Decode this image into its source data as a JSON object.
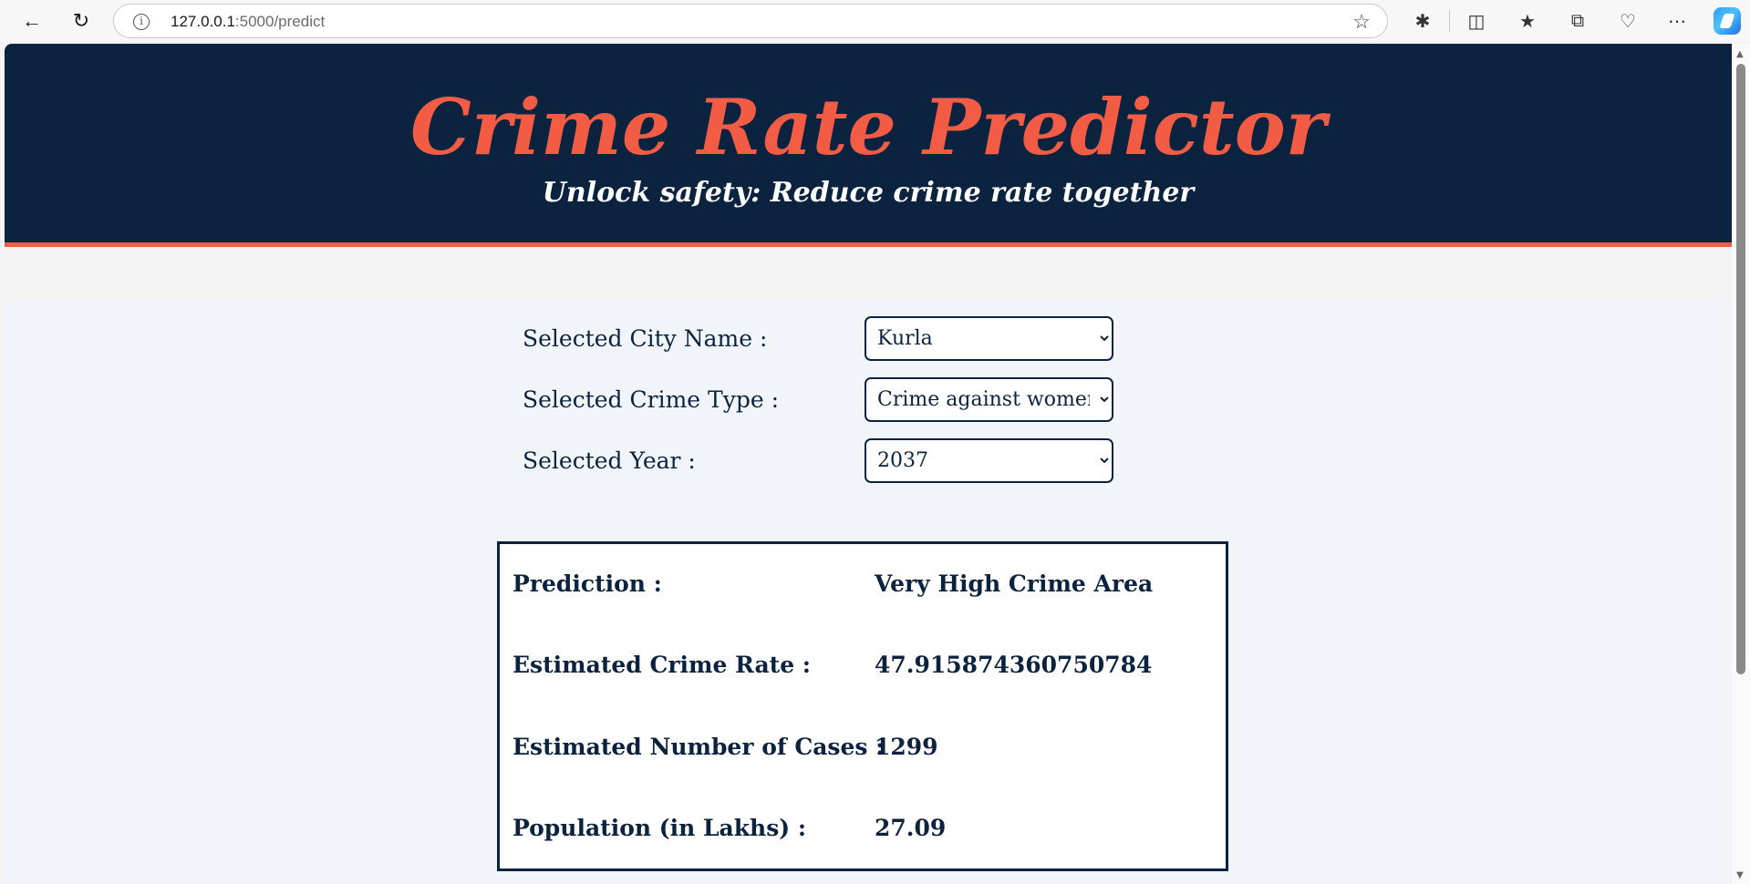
{
  "browser": {
    "url_host": "127.0.0.1",
    "url_path": ":5000/predict"
  },
  "header": {
    "title": "Crime Rate Predictor",
    "subtitle": "Unlock safety: Reduce crime rate together"
  },
  "form": {
    "city_label": "Selected City Name :",
    "city_value": "Kurla",
    "crime_label": "Selected Crime Type :",
    "crime_value": "Crime against women",
    "year_label": "Selected Year :",
    "year_value": "2037"
  },
  "results": {
    "prediction_label": "Prediction :",
    "prediction_value": "Very High Crime Area",
    "rate_label": "Estimated Crime Rate :",
    "rate_value": "47.915874360750784",
    "cases_label": "Estimated Number of Cases :",
    "cases_value": "1299",
    "population_label": "Population (in Lakhs) :",
    "population_value": "27.09"
  },
  "colors": {
    "header_bg": "#0c2340",
    "accent": "#f25c45",
    "text": "#0c2340"
  }
}
